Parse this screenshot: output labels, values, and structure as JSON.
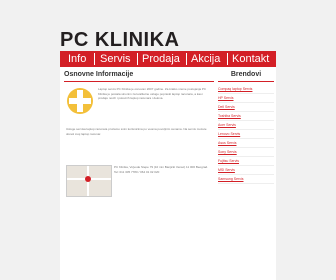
{
  "logo": {
    "pc": "PC",
    "name": "KLINIKA"
  },
  "nav": [
    {
      "label": "Info"
    },
    {
      "label": "Servis"
    },
    {
      "label": "Prodaja"
    },
    {
      "label": "Akcija"
    },
    {
      "label": "Kontakt"
    }
  ],
  "main": {
    "heading": "Osnovne Informacije",
    "para1": "Laptop servis PC Klinika je osnovan 2007 godine. Za kratko vreme postojanja PC Klinika je postala sinonim za kvalitetne usluge popravki laptop racunara, a kao i prodaju novih i polovnih laptop racunara i delova.",
    "para2": "Usluge servisa laptop racunara pruzamo svim korisnicima po veoma povoljnim cenama. Na servis mozete doneti svoj laptop racunar.",
    "para3": "PC Klinika, Vojvode Stepe 79 (10 min Banjicki Venac) 11 000 Beograd. Tel: 011 305 7780 / 064 01 02 020"
  },
  "sidebar": {
    "heading": "Brendovi",
    "brands": [
      "Compaq laptop Servis",
      "HP Servis",
      "Dell Servis",
      "Toshiba Servis",
      "Acer Servis",
      "Lenovo Servis",
      "Asus Servis",
      "Sony Servis",
      "Fujitsu Servis",
      "MSI Servis",
      "Samsung Servis"
    ]
  },
  "colors": {
    "accent": "#d31f26",
    "background": "#f1f1f1"
  }
}
